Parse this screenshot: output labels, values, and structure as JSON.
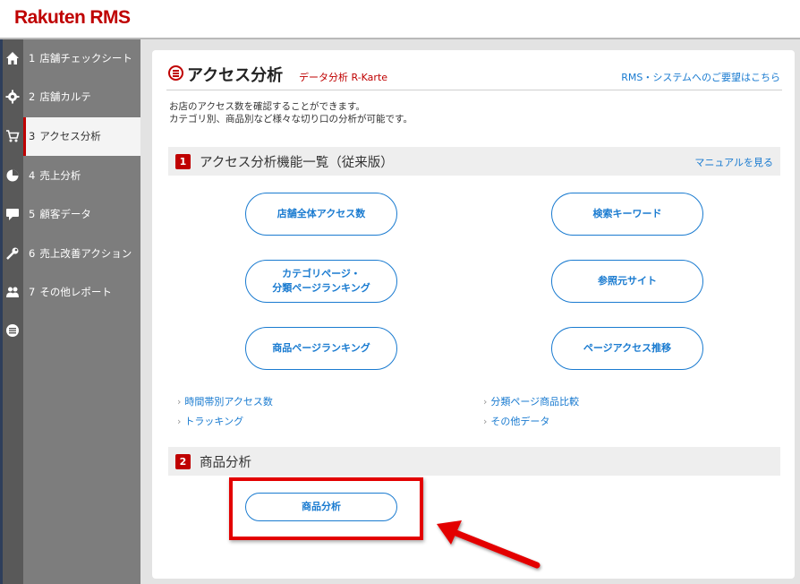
{
  "header": {
    "logo_main": "Rakuten",
    "logo_sub": "RMS"
  },
  "sidebar": {
    "items": [
      {
        "num": "1",
        "label": "店舗チェックシート",
        "icon": "home-icon"
      },
      {
        "num": "2",
        "label": "店舗カルテ",
        "icon": "gear-icon"
      },
      {
        "num": "3",
        "label": "アクセス分析",
        "icon": "cart-icon",
        "active": true
      },
      {
        "num": "4",
        "label": "売上分析",
        "icon": "pie-chart-icon"
      },
      {
        "num": "5",
        "label": "顧客データ",
        "icon": "chat-icon"
      },
      {
        "num": "6",
        "label": "売上改善アクション",
        "icon": "tools-icon"
      },
      {
        "num": "7",
        "label": "その他レポート",
        "icon": "users-icon"
      }
    ],
    "extra_icon": "list-icon"
  },
  "main": {
    "title": "アクセス分析",
    "subtitle": "データ分析 R-Karte",
    "top_link": "RMS・システムへのご要望はこちら",
    "desc_line1": "お店のアクセス数を確認することができます。",
    "desc_line2": "カテゴリ別、商品別など様々な切り口の分析が可能です。",
    "section1": {
      "num": "1",
      "title": "アクセス分析機能一覧（従来版）",
      "manual_link": "マニュアルを見る",
      "buttons": {
        "store_access": "店舗全体アクセス数",
        "search_keyword": "検索キーワード",
        "category_line1": "カテゴリページ・",
        "category_line2": "分類ページランキング",
        "referrer": "参照元サイト",
        "product_ranking": "商品ページランキング",
        "page_access_trend": "ページアクセス推移"
      },
      "links": {
        "hourly": "時間帯別アクセス数",
        "category_compare": "分類ページ商品比較",
        "tracking": "トラッキング",
        "other_data": "その他データ"
      }
    },
    "section2": {
      "num": "2",
      "title": "商品分析",
      "button": "商品分析"
    }
  },
  "colors": {
    "brand_red": "#bf0000",
    "link_blue": "#1a7bd0",
    "annotation_red": "#e30000"
  }
}
